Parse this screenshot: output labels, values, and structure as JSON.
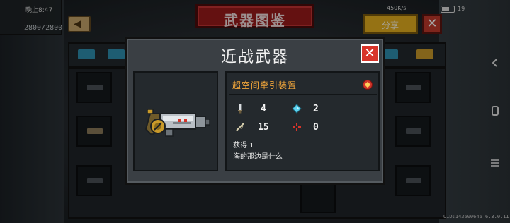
{
  "status_bar": {
    "time": "晚上8:47",
    "network": "450K/s",
    "battery": "19"
  },
  "hud": {
    "counter": "2800/2800"
  },
  "header": {
    "title": "武器图鉴",
    "share_label": "分享",
    "close_label": "✕"
  },
  "modal": {
    "title": "近战武器",
    "close_label": "✕",
    "weapon": {
      "name": "超空间牵引装置",
      "stats": {
        "damage": "4",
        "energy": "2",
        "crit": "15",
        "accuracy": "0"
      },
      "obtained": "获得 1",
      "description": "海的那边是什么"
    }
  },
  "footer": {
    "version": "UID:143600646  6.3.0.II"
  },
  "colors": {
    "title_banner": "#9a1b1b",
    "share_button": "#e5b020",
    "close_button": "#d8342a",
    "weapon_name": "#f0a53a",
    "energy_icon": "#5fd4f0",
    "accuracy_icon": "#d8342a"
  },
  "icons": {
    "damage": "sword-icon",
    "energy": "diamond-icon",
    "crit": "feather-icon",
    "accuracy": "crosshair-icon"
  }
}
